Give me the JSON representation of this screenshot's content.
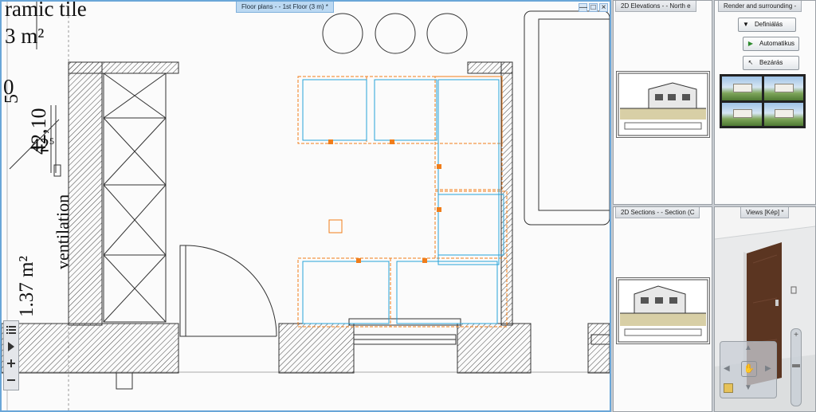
{
  "main_view": {
    "title": "Floor plans -  - 1st Floor (3 m) *",
    "drawing_labels": {
      "tile": "ramic tile",
      "area_top": "3 m²",
      "dim_zero": "0",
      "dim_five": "5",
      "dim_main": "42,10",
      "dim_small": "42",
      "dim_small_sup": "5",
      "ventilation": "ventilation",
      "area_bottom": "1.37 m²"
    },
    "window_buttons": [
      "—",
      "□",
      "×"
    ]
  },
  "side_tools": [
    "list-icon",
    "play-icon",
    "plus-icon",
    "minus-icon"
  ],
  "panels": {
    "elevations": {
      "title": "2D Elevations -  - North e"
    },
    "render": {
      "title": "Render and surrounding -",
      "buttons": {
        "define": "Definiálás",
        "auto": "Automatikus",
        "close": "Bezárás"
      }
    },
    "sections": {
      "title": "2D Sections -  - Section (C"
    },
    "views": {
      "title": "Views [Kép] *"
    }
  },
  "colors": {
    "selection": "#f07d1a",
    "cabinet": "#27a3d8",
    "active_frame": "#6aa6d8",
    "door": "#5b3521"
  }
}
